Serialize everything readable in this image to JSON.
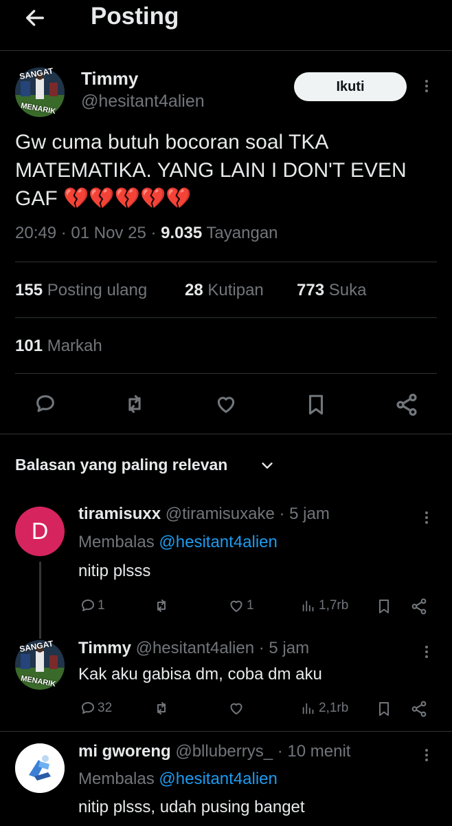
{
  "header": {
    "title": "Posting"
  },
  "post": {
    "author_name": "Timmy",
    "author_handle": "@hesitant4alien",
    "follow_label": "Ikuti",
    "avatar_text_top": "SANGAT",
    "avatar_text_bottom": "MENARIK",
    "text": "Gw cuma butuh bocoran soal TKA MATEMATIKA. YANG LAIN I DON'T EVEN GAF 💔💔💔💔💔",
    "time": "20:49 · 01 Nov 25 ·",
    "views_count": "9.035",
    "views_label": "Tayangan"
  },
  "stats": {
    "reposts_count": "155",
    "reposts_label": "Posting ulang",
    "quotes_count": "28",
    "quotes_label": "Kutipan",
    "likes_count": "773",
    "likes_label": "Suka",
    "bookmarks_count": "101",
    "bookmarks_label": "Markah"
  },
  "replies_header": {
    "label": "Balasan yang paling relevan"
  },
  "replies": [
    {
      "avatar_letter": "D",
      "avatar_color": "#d6245e",
      "name": "tiramisuxx",
      "handle": "@tiramisuxake",
      "time": "· 5 jam",
      "replying_prefix": "Membalas",
      "replying_to": "@hesitant4alien",
      "text": "nitip plsss",
      "reply_count": "1",
      "like_count": "1",
      "views": "1,7rb"
    },
    {
      "name": "Timmy",
      "handle": "@hesitant4alien",
      "time": "· 5 jam",
      "text": "Kak aku gabisa dm, coba dm aku",
      "reply_count": "32",
      "views": "2,1rb"
    },
    {
      "name": "mi gworeng",
      "handle": "@blluberrys_",
      "time": "· 10 menit",
      "replying_prefix": "Membalas",
      "replying_to": "@hesitant4alien",
      "text": "nitip plsss, udah pusing banget"
    }
  ]
}
